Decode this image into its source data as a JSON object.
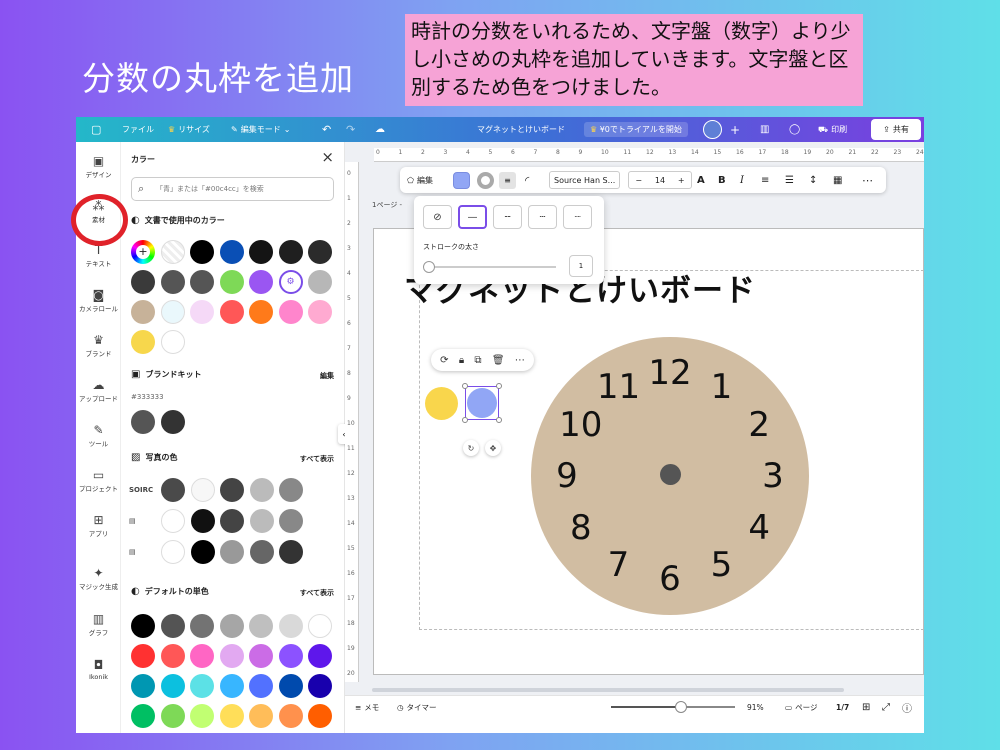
{
  "slide": {
    "title": "分数の丸枠を追加",
    "note": "時計の分数をいれるため、文字盤（数字）より少し小さめの丸枠を追加していきます。文字盤と区別するため色をつけました。"
  },
  "topbar": {
    "file": "ファイル",
    "resize": "リサイズ",
    "mode": "編集モード",
    "doc_title": "マグネットとけいボード",
    "trial": "¥0でトライアルを開始",
    "print": "印刷",
    "share": "共有"
  },
  "rail": [
    {
      "label": "デザイン",
      "icon": "layout-icon",
      "glyph": "▣"
    },
    {
      "label": "素材",
      "icon": "elements-icon",
      "glyph": "⁂"
    },
    {
      "label": "テキスト",
      "icon": "text-icon",
      "glyph": "T"
    },
    {
      "label": "カメラロール",
      "icon": "camera-icon",
      "glyph": "◙"
    },
    {
      "label": "ブランド",
      "icon": "brand-icon",
      "glyph": "♛"
    },
    {
      "label": "アップロード",
      "icon": "upload-icon",
      "glyph": "☁"
    },
    {
      "label": "ツール",
      "icon": "pen-icon",
      "glyph": "✎"
    },
    {
      "label": "プロジェクト",
      "icon": "folder-icon",
      "glyph": "▭"
    },
    {
      "label": "アプリ",
      "icon": "apps-icon",
      "glyph": "⊞"
    },
    {
      "label": "マジック生成",
      "icon": "magic-icon",
      "glyph": "✦"
    },
    {
      "label": "グラフ",
      "icon": "chart-icon",
      "glyph": "▥"
    },
    {
      "label": "Ikonik",
      "icon": "ikonik-icon",
      "glyph": "◘"
    }
  ],
  "panel": {
    "title": "カラー",
    "search_placeholder": "「青」または「#00c4cc」を検索",
    "doc_colors_title": "文書で使用中のカラー",
    "doc_colors_row1": [
      "#000000",
      "#0a4fb5",
      "#141414",
      "#1f1f1f",
      "#2b2b2b"
    ],
    "doc_colors_row2": [
      "#3a3a3a",
      "#555555",
      "#555555",
      "#7ed957",
      "#9a56f2",
      "#ffffff",
      "#b7b7b7"
    ],
    "doc_colors_row3": [
      "#c7b299",
      "#eaf8fc",
      "#f5d9f7",
      "#ff5757",
      "#ff7a1a",
      "#ff85cc",
      "#ffaad1"
    ],
    "doc_colors_row4": [
      "#f7d74c",
      "#ffffff"
    ],
    "brand_title": "ブランドキット",
    "brand_edit": "編集",
    "brand_hex": "#333333",
    "brand_colors": [
      "#555555",
      "#333333"
    ],
    "photo_title": "写真の色",
    "show_all": "すべて表示",
    "photo_rows": [
      {
        "thumb": "SOIRC",
        "colors": [
          "#4a4a4a",
          "#f7f7f7",
          "#444444",
          "#bbbbbb",
          "#888888"
        ]
      },
      {
        "thumb": "",
        "colors": [
          "#ffffff",
          "#111111",
          "#444444",
          "#bbbbbb",
          "#888888"
        ]
      },
      {
        "thumb": "",
        "colors": [
          "#ffffff",
          "#000000",
          "#999999",
          "#666666",
          "#333333"
        ]
      }
    ],
    "default_title": "デフォルトの単色",
    "default_rows": [
      [
        "#000000",
        "#545454",
        "#737373",
        "#a6a6a6",
        "#bfbfbf",
        "#d9d9d9",
        "#ffffff"
      ],
      [
        "#ff3131",
        "#ff5757",
        "#ff66c4",
        "#e2a9f1",
        "#cb6ce6",
        "#8c52ff",
        "#5e17eb"
      ],
      [
        "#0097b2",
        "#0cc0df",
        "#5ce1e6",
        "#38b6ff",
        "#5271ff",
        "#004aad",
        "#1800ad"
      ],
      [
        "#00bf63",
        "#7ed957",
        "#c1ff72",
        "#ffde59",
        "#ffbd59",
        "#ff914d",
        "#ff5e00"
      ]
    ]
  },
  "context_toolbar": {
    "edit": "編集",
    "font": "Source Han S...",
    "size": "14",
    "bold": "B",
    "italic": "I",
    "minus": "−",
    "plus": "+"
  },
  "stroke_popup": {
    "label": "ストロークの太さ",
    "value": "1"
  },
  "page_label": "1ページ -",
  "canvas": {
    "board_title": "マグネットとけいボード",
    "clock_numbers": [
      "12",
      "1",
      "2",
      "3",
      "4",
      "5",
      "6",
      "7",
      "8",
      "9",
      "10",
      "11"
    ],
    "clock_face_color": "#d1bda2"
  },
  "footer": {
    "memo": "メモ",
    "timer": "タイマー",
    "zoom": "91%",
    "zoom_level": 0.55,
    "pages": "ページ",
    "page_count": "1/7"
  }
}
